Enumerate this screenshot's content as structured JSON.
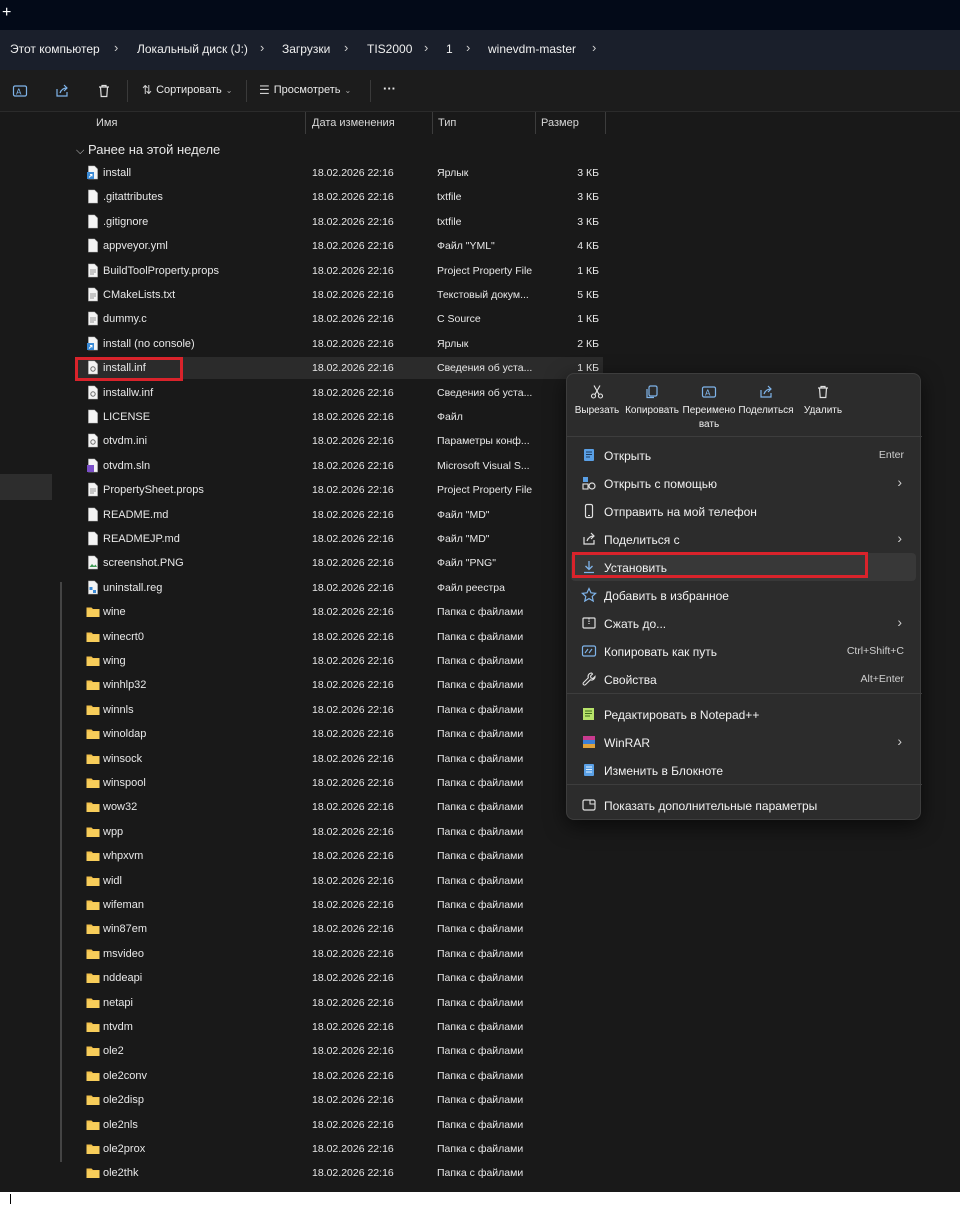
{
  "tabbar": {
    "new_tab": "+"
  },
  "breadcrumb": [
    "Этот компьютер",
    "Локальный диск (J:)",
    "Загрузки",
    "TIS2000",
    "1",
    "winevdm-master"
  ],
  "toolbar": {
    "sort_label": "Сортировать",
    "view_label": "Просмотреть",
    "more_label": "···"
  },
  "columns": {
    "name": "Имя",
    "date": "Дата изменения",
    "type": "Тип",
    "size": "Размер"
  },
  "group_label": "Ранее на этой неделе",
  "files": [
    {
      "name": "install",
      "date": "18.02.2026 22:16",
      "type": "Ярлык",
      "size": "3 КБ",
      "icon": "shortcut"
    },
    {
      "name": ".gitattributes",
      "date": "18.02.2026 22:16",
      "type": "txtfile",
      "size": "3 КБ",
      "icon": "file"
    },
    {
      "name": ".gitignore",
      "date": "18.02.2026 22:16",
      "type": "txtfile",
      "size": "3 КБ",
      "icon": "file"
    },
    {
      "name": "appveyor.yml",
      "date": "18.02.2026 22:16",
      "type": "Файл \"YML\"",
      "size": "4 КБ",
      "icon": "file"
    },
    {
      "name": "BuildToolProperty.props",
      "date": "18.02.2026 22:16",
      "type": "Project Property File",
      "size": "1 КБ",
      "icon": "doc"
    },
    {
      "name": "CMakeLists.txt",
      "date": "18.02.2026 22:16",
      "type": "Текстовый докум...",
      "size": "5 КБ",
      "icon": "doc"
    },
    {
      "name": "dummy.c",
      "date": "18.02.2026 22:16",
      "type": "C Source",
      "size": "1 КБ",
      "icon": "doc"
    },
    {
      "name": "install (no console)",
      "date": "18.02.2026 22:16",
      "type": "Ярлык",
      "size": "2 КБ",
      "icon": "shortcut"
    },
    {
      "name": "install.inf",
      "date": "18.02.2026 22:16",
      "type": "Сведения об уста...",
      "size": "1 КБ",
      "icon": "inf"
    },
    {
      "name": "installw.inf",
      "date": "18.02.2026 22:16",
      "type": "Сведения об уста...",
      "size": "",
      "icon": "inf"
    },
    {
      "name": "LICENSE",
      "date": "18.02.2026 22:16",
      "type": "Файл",
      "size": "",
      "icon": "file"
    },
    {
      "name": "otvdm.ini",
      "date": "18.02.2026 22:16",
      "type": "Параметры конф...",
      "size": "",
      "icon": "inf"
    },
    {
      "name": "otvdm.sln",
      "date": "18.02.2026 22:16",
      "type": "Microsoft Visual S...",
      "size": "",
      "icon": "sln"
    },
    {
      "name": "PropertySheet.props",
      "date": "18.02.2026 22:16",
      "type": "Project Property File",
      "size": "",
      "icon": "doc"
    },
    {
      "name": "README.md",
      "date": "18.02.2026 22:16",
      "type": "Файл \"MD\"",
      "size": "",
      "icon": "file"
    },
    {
      "name": "READMEJP.md",
      "date": "18.02.2026 22:16",
      "type": "Файл \"MD\"",
      "size": "",
      "icon": "file"
    },
    {
      "name": "screenshot.PNG",
      "date": "18.02.2026 22:16",
      "type": "Файл \"PNG\"",
      "size": "",
      "icon": "image"
    },
    {
      "name": "uninstall.reg",
      "date": "18.02.2026 22:16",
      "type": "Файл реестра",
      "size": "",
      "icon": "reg"
    },
    {
      "name": "wine",
      "date": "18.02.2026 22:16",
      "type": "Папка с файлами",
      "size": "",
      "icon": "folder"
    },
    {
      "name": "winecrt0",
      "date": "18.02.2026 22:16",
      "type": "Папка с файлами",
      "size": "",
      "icon": "folder"
    },
    {
      "name": "wing",
      "date": "18.02.2026 22:16",
      "type": "Папка с файлами",
      "size": "",
      "icon": "folder"
    },
    {
      "name": "winhlp32",
      "date": "18.02.2026 22:16",
      "type": "Папка с файлами",
      "size": "",
      "icon": "folder"
    },
    {
      "name": "winnls",
      "date": "18.02.2026 22:16",
      "type": "Папка с файлами",
      "size": "",
      "icon": "folder"
    },
    {
      "name": "winoldap",
      "date": "18.02.2026 22:16",
      "type": "Папка с файлами",
      "size": "",
      "icon": "folder"
    },
    {
      "name": "winsock",
      "date": "18.02.2026 22:16",
      "type": "Папка с файлами",
      "size": "",
      "icon": "folder"
    },
    {
      "name": "winspool",
      "date": "18.02.2026 22:16",
      "type": "Папка с файлами",
      "size": "",
      "icon": "folder"
    },
    {
      "name": "wow32",
      "date": "18.02.2026 22:16",
      "type": "Папка с файлами",
      "size": "",
      "icon": "folder"
    },
    {
      "name": "wpp",
      "date": "18.02.2026 22:16",
      "type": "Папка с файлами",
      "size": "",
      "icon": "folder"
    },
    {
      "name": "whpxvm",
      "date": "18.02.2026 22:16",
      "type": "Папка с файлами",
      "size": "",
      "icon": "folder"
    },
    {
      "name": "widl",
      "date": "18.02.2026 22:16",
      "type": "Папка с файлами",
      "size": "",
      "icon": "folder"
    },
    {
      "name": "wifeman",
      "date": "18.02.2026 22:16",
      "type": "Папка с файлами",
      "size": "",
      "icon": "folder"
    },
    {
      "name": "win87em",
      "date": "18.02.2026 22:16",
      "type": "Папка с файлами",
      "size": "",
      "icon": "folder"
    },
    {
      "name": "msvideo",
      "date": "18.02.2026 22:16",
      "type": "Папка с файлами",
      "size": "",
      "icon": "folder"
    },
    {
      "name": "nddeapi",
      "date": "18.02.2026 22:16",
      "type": "Папка с файлами",
      "size": "",
      "icon": "folder"
    },
    {
      "name": "netapi",
      "date": "18.02.2026 22:16",
      "type": "Папка с файлами",
      "size": "",
      "icon": "folder"
    },
    {
      "name": "ntvdm",
      "date": "18.02.2026 22:16",
      "type": "Папка с файлами",
      "size": "",
      "icon": "folder"
    },
    {
      "name": "ole2",
      "date": "18.02.2026 22:16",
      "type": "Папка с файлами",
      "size": "",
      "icon": "folder"
    },
    {
      "name": "ole2conv",
      "date": "18.02.2026 22:16",
      "type": "Папка с файлами",
      "size": "",
      "icon": "folder"
    },
    {
      "name": "ole2disp",
      "date": "18.02.2026 22:16",
      "type": "Папка с файлами",
      "size": "",
      "icon": "folder"
    },
    {
      "name": "ole2nls",
      "date": "18.02.2026 22:16",
      "type": "Папка с файлами",
      "size": "",
      "icon": "folder"
    },
    {
      "name": "ole2prox",
      "date": "18.02.2026 22:16",
      "type": "Папка с файлами",
      "size": "",
      "icon": "folder"
    },
    {
      "name": "ole2thk",
      "date": "18.02.2026 22:16",
      "type": "Папка с файлами",
      "size": "",
      "icon": "folder"
    }
  ],
  "context_menu": {
    "actions": [
      {
        "label": "Вырезать",
        "icon": "scissors-icon"
      },
      {
        "label": "Копировать",
        "icon": "copy-icon"
      },
      {
        "label": "Переименовать",
        "icon": "rename-icon"
      },
      {
        "label": "Поделиться",
        "icon": "share-icon"
      },
      {
        "label": "Удалить",
        "icon": "trash-icon"
      }
    ],
    "items": [
      {
        "label": "Открыть",
        "shortcut": "Enter",
        "submenu": false,
        "icon": "open-icon"
      },
      {
        "label": "Открыть с помощью",
        "shortcut": "",
        "submenu": true,
        "icon": "open-with-icon"
      },
      {
        "label": "Отправить на мой телефон",
        "shortcut": "",
        "submenu": false,
        "icon": "phone-icon"
      },
      {
        "label": "Поделиться с",
        "shortcut": "",
        "submenu": true,
        "icon": "share-with-icon"
      },
      {
        "label": "Установить",
        "shortcut": "",
        "submenu": false,
        "icon": "install-icon"
      },
      {
        "label": "Добавить в избранное",
        "shortcut": "",
        "submenu": false,
        "icon": "star-icon"
      },
      {
        "label": "Сжать до...",
        "shortcut": "",
        "submenu": true,
        "icon": "archive-icon"
      },
      {
        "label": "Копировать как путь",
        "shortcut": "Ctrl+Shift+C",
        "submenu": false,
        "icon": "copy-path-icon"
      },
      {
        "label": "Свойства",
        "shortcut": "Alt+Enter",
        "submenu": false,
        "icon": "wrench-icon"
      },
      {
        "label": "Редактировать в Notepad++",
        "shortcut": "",
        "submenu": false,
        "icon": "notepadpp-icon"
      },
      {
        "label": "WinRAR",
        "shortcut": "",
        "submenu": true,
        "icon": "winrar-icon"
      },
      {
        "label": "Изменить в Блокноте",
        "shortcut": "",
        "submenu": false,
        "icon": "notepad-icon"
      },
      {
        "label": "Показать дополнительные параметры",
        "shortcut": "",
        "submenu": false,
        "icon": "more-options-icon"
      }
    ]
  },
  "colors": {
    "highlight_red": "#d9232b",
    "folder": "#f2c04a",
    "accent_blue": "#5aa0e6"
  }
}
